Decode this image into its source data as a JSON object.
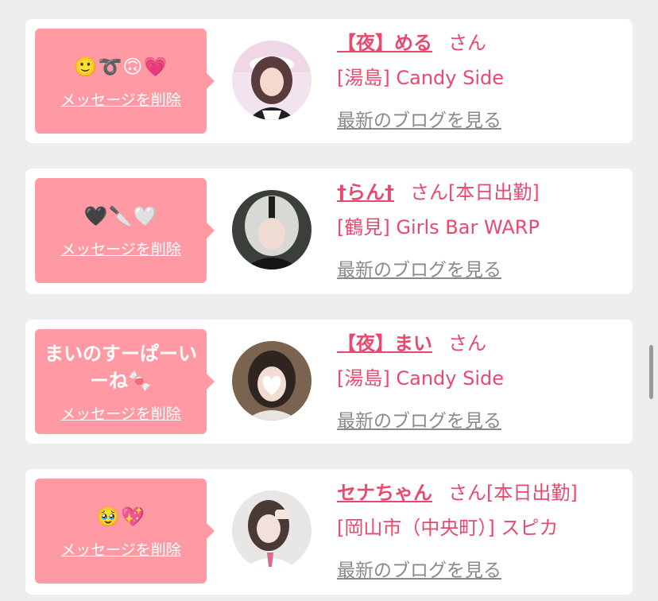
{
  "delete_label": "メッセージを削除",
  "san_label": "さん",
  "blog_label": "最新のブログを見る",
  "colors": {
    "accent": "#e84a6e",
    "bubble": "#ff9aa4",
    "link_gray": "#8a8a8a",
    "background": "#eeeeee"
  },
  "cards": [
    {
      "message": "🙂➰🙃💗",
      "name": "【夜】める",
      "status": "",
      "shop": "[湯島] Candy Side"
    },
    {
      "message": "🖤🔪🤍",
      "name": "†らん†",
      "status": "[本日出勤]",
      "shop": "[鶴見] Girls Bar WARP"
    },
    {
      "message": "まいのすーぱーいーね🍬",
      "name": "【夜】まい",
      "status": "",
      "shop": "[湯島] Candy Side"
    },
    {
      "message": "🥹💖",
      "name": "セナちゃん",
      "status": "[本日出勤]",
      "shop": "[岡山市（中央町）] スピカ"
    }
  ]
}
